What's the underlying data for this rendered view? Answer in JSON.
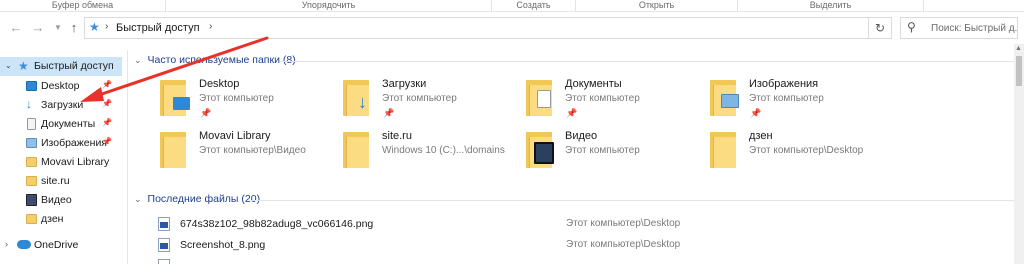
{
  "ribbon": {
    "groups": [
      "Буфер обмена",
      "Упорядочить",
      "Создать",
      "Открыть",
      "Выделить"
    ]
  },
  "nav": {
    "back_icon": "arrow-left-icon",
    "forward_icon": "arrow-right-icon",
    "recent_icon": "chevron-down-icon",
    "up_icon": "arrow-up-icon"
  },
  "address": {
    "crumb": "Быстрый доступ",
    "refresh_icon": "refresh-icon"
  },
  "search": {
    "placeholder": "Поиск: Быстрый д..."
  },
  "sidebar": {
    "quick_access": "Быстрый доступ",
    "items": [
      {
        "label": "Desktop",
        "pinned": true
      },
      {
        "label": "Загрузки",
        "pinned": true
      },
      {
        "label": "Документы",
        "pinned": true
      },
      {
        "label": "Изображения",
        "pinned": true
      },
      {
        "label": "Movavi Library",
        "pinned": false
      },
      {
        "label": "site.ru",
        "pinned": false
      },
      {
        "label": "Видео",
        "pinned": false
      },
      {
        "label": "дзен",
        "pinned": false
      }
    ],
    "onedrive": "OneDrive"
  },
  "frequent": {
    "header": "Часто используемые папки (8)",
    "folders": [
      {
        "name": "Desktop",
        "path": "Этот компьютер",
        "pinned": true
      },
      {
        "name": "Загрузки",
        "path": "Этот компьютер",
        "pinned": true
      },
      {
        "name": "Документы",
        "path": "Этот компьютер",
        "pinned": true
      },
      {
        "name": "Изображения",
        "path": "Этот компьютер",
        "pinned": true
      },
      {
        "name": "Movavi Library",
        "path": "Этот компьютер\\Видео",
        "pinned": false
      },
      {
        "name": "site.ru",
        "path": "Windows 10 (C:)...\\domains",
        "pinned": false
      },
      {
        "name": "Видео",
        "path": "Этот компьютер",
        "pinned": false
      },
      {
        "name": "дзен",
        "path": "Этот компьютер\\Desktop",
        "pinned": false
      }
    ]
  },
  "recent": {
    "header": "Последние файлы (20)",
    "files": [
      {
        "name": "674s38z102_98b82adug8_vc066146.png",
        "location": "Этот компьютер\\Desktop"
      },
      {
        "name": "Screenshot_8.png",
        "location": "Этот компьютер\\Desktop"
      }
    ]
  },
  "colors": {
    "annotation_arrow": "#e8312a",
    "selection": "#cce4f7",
    "section_header": "#1c3f8e"
  }
}
